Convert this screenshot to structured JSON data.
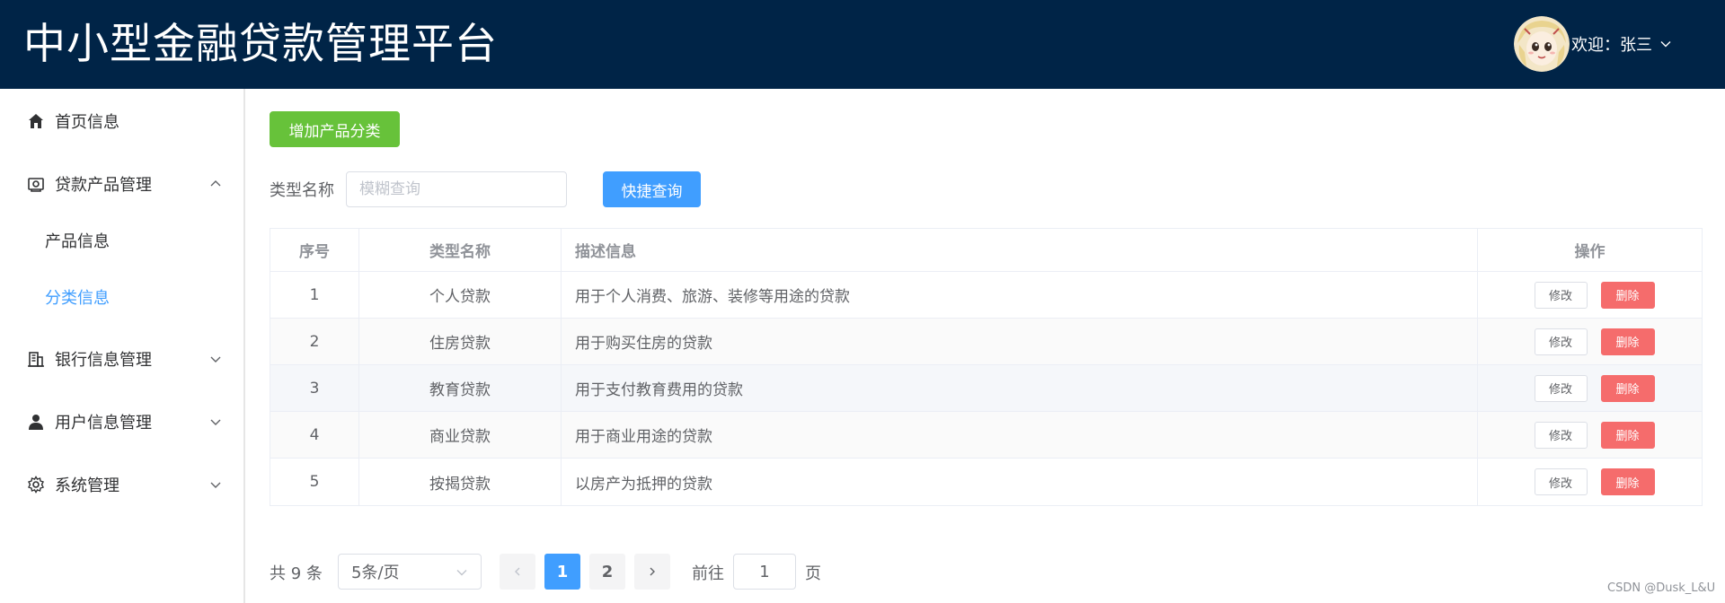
{
  "header": {
    "title": "中小型金融贷款管理平台",
    "welcome": "欢迎：张三"
  },
  "sidebar": {
    "items": [
      {
        "label": "首页信息",
        "icon": "home-icon"
      },
      {
        "label": "贷款产品管理",
        "icon": "product-icon",
        "expanded": true,
        "children": [
          {
            "label": "产品信息",
            "active": false
          },
          {
            "label": "分类信息",
            "active": true
          }
        ]
      },
      {
        "label": "银行信息管理",
        "icon": "bank-icon"
      },
      {
        "label": "用户信息管理",
        "icon": "user-icon"
      },
      {
        "label": "系统管理",
        "icon": "gear-icon"
      }
    ]
  },
  "toolbar": {
    "add_label": "增加产品分类",
    "filter_label": "类型名称",
    "filter_placeholder": "模糊查询",
    "filter_value": "",
    "search_label": "快捷查询"
  },
  "table": {
    "headers": [
      "序号",
      "类型名称",
      "描述信息",
      "操作"
    ],
    "rows": [
      {
        "no": "1",
        "name": "个人贷款",
        "desc": "用于个人消费、旅游、装修等用途的贷款"
      },
      {
        "no": "2",
        "name": "住房贷款",
        "desc": "用于购买住房的贷款"
      },
      {
        "no": "3",
        "name": "教育贷款",
        "desc": "用于支付教育费用的贷款"
      },
      {
        "no": "4",
        "name": "商业贷款",
        "desc": "用于商业用途的贷款"
      },
      {
        "no": "5",
        "name": "按揭贷款",
        "desc": "以房产为抵押的贷款"
      }
    ],
    "edit_label": "修改",
    "delete_label": "删除"
  },
  "pagination": {
    "total": "共 9 条",
    "page_size": "5条/页",
    "pages": [
      "1",
      "2"
    ],
    "current": "1",
    "goto_label": "前往",
    "goto_value": "1",
    "page_suffix": "页"
  },
  "watermark": "CSDN @Dusk_L&U",
  "colors": {
    "header_bg": "#002447",
    "primary": "#409eff",
    "success": "#67c23a",
    "danger": "#f56c6c"
  }
}
